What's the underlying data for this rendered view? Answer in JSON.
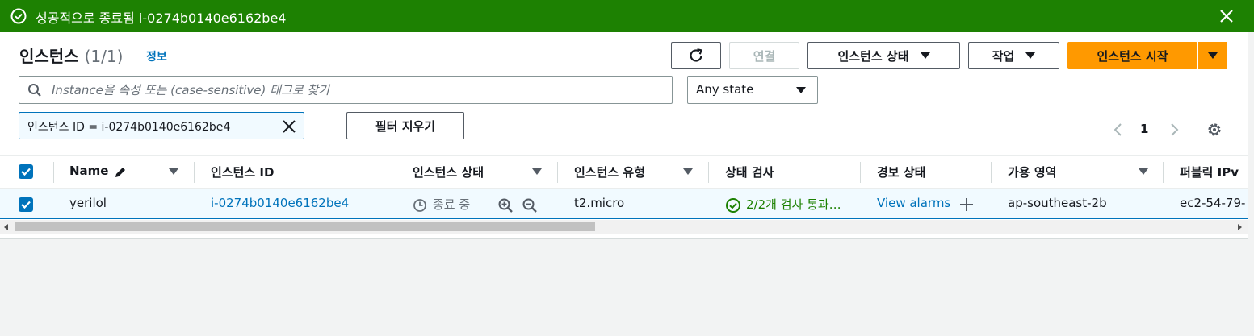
{
  "flash": {
    "message": "성공적으로 종료됨 i-0274b0140e6162be4",
    "color": "#1d8102"
  },
  "header": {
    "title": "인스턴스",
    "count": "(1/1)",
    "info": "정보"
  },
  "toolbar": {
    "connect": "연결",
    "instance_state": "인스턴스 상태",
    "actions": "작업",
    "launch": "인스턴스 시작",
    "accent": "#ff9900"
  },
  "search": {
    "placeholder": "Instance을 속성 또는 (case-sensitive) 태그로 찾기"
  },
  "state_filter": {
    "value": "Any state"
  },
  "filter_token": {
    "label": "인스턴스 ID = i-0274b0140e6162be4"
  },
  "clear_filters": "필터 지우기",
  "pagination": {
    "page": "1"
  },
  "table": {
    "columns": [
      "Name",
      "인스턴스 ID",
      "인스턴스 상태",
      "인스턴스 유형",
      "상태 검사",
      "경보 상태",
      "가용 영역",
      "퍼블릭 IPv"
    ],
    "rows": [
      {
        "name": "yerilol",
        "instance_id": "i-0274b0140e6162be4",
        "state": "종료 중",
        "type": "t2.micro",
        "status_check": "2/2개 검사 통과…",
        "alarm": "View alarms",
        "az": "ap-southeast-2b",
        "public_dns": "ec2-54-79-"
      }
    ]
  }
}
